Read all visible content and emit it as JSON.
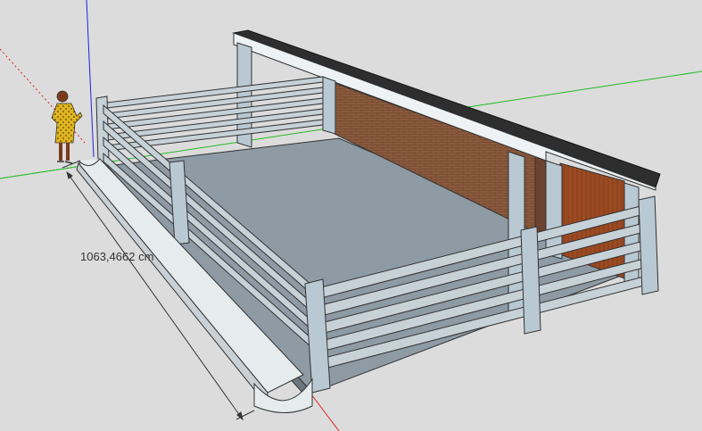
{
  "viewport": {
    "dimension_label": "1063,4662 cm"
  },
  "colors": {
    "background": "#dcdcdc",
    "floor": "#8e9aa4",
    "rail": "#c7d1d8",
    "post": "#b9c9d3",
    "roof_top": "#2e2e2e",
    "roof_fascia": "#eef2f4",
    "brick": "#8a5a3c",
    "wood_door": "#9b4a23",
    "trough": "#e6ebee",
    "axis_red": "#e02020",
    "axis_green": "#22bb22",
    "axis_blue": "#2222dd"
  },
  "icons": {
    "scale_figure": "person-figure"
  }
}
